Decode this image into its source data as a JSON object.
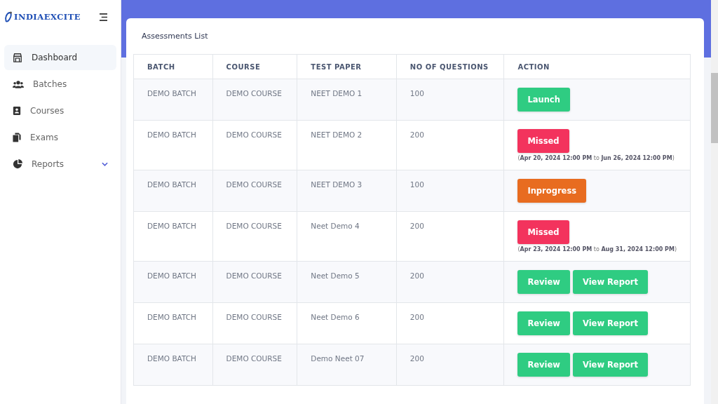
{
  "brand": {
    "name": "INDIAEXCITE"
  },
  "sidebar": {
    "items": [
      {
        "label": "Dashboard",
        "selected": true,
        "expandable": false
      },
      {
        "label": "Batches",
        "selected": false,
        "expandable": false
      },
      {
        "label": "Courses",
        "selected": false,
        "expandable": false
      },
      {
        "label": "Exams",
        "selected": false,
        "expandable": false
      },
      {
        "label": "Reports",
        "selected": false,
        "expandable": true
      }
    ]
  },
  "card": {
    "title": "Assessments List"
  },
  "table": {
    "columns": [
      "BATCH",
      "COURSE",
      "TEST PAPER",
      "NO OF QUESTIONS",
      "ACTION"
    ],
    "rows": [
      {
        "batch": "DEMO BATCH",
        "course": "DEMO COURSE",
        "paper": "NEET DEMO 1",
        "questions": "100",
        "actions": [
          {
            "kind": "launch",
            "label": "Launch"
          }
        ]
      },
      {
        "batch": "DEMO BATCH",
        "course": "DEMO COURSE",
        "paper": "NEET DEMO 2",
        "questions": "200",
        "actions": [
          {
            "kind": "missed",
            "label": "Missed"
          }
        ],
        "window": "(**Apr 20, 2024 12:00 PM** to **Jun 26, 2024 12:00 PM**)"
      },
      {
        "batch": "DEMO BATCH",
        "course": "DEMO COURSE",
        "paper": "NEET DEMO 3",
        "questions": "100",
        "actions": [
          {
            "kind": "inprogress",
            "label": "Inprogress"
          }
        ]
      },
      {
        "batch": "DEMO BATCH",
        "course": "DEMO COURSE",
        "paper": "Neet Demo 4",
        "questions": "200",
        "actions": [
          {
            "kind": "missed",
            "label": "Missed"
          }
        ],
        "window": "(**Apr 23, 2024 12:00 PM** to **Aug 31, 2024 12:00 PM**)"
      },
      {
        "batch": "DEMO BATCH",
        "course": "DEMO COURSE",
        "paper": "Neet Demo 5",
        "questions": "200",
        "actions": [
          {
            "kind": "review",
            "label": "Review"
          },
          {
            "kind": "report",
            "label": "View Report"
          }
        ]
      },
      {
        "batch": "DEMO BATCH",
        "course": "DEMO COURSE",
        "paper": "Neet Demo 6",
        "questions": "200",
        "actions": [
          {
            "kind": "review",
            "label": "Review"
          },
          {
            "kind": "report",
            "label": "View Report"
          }
        ]
      },
      {
        "batch": "DEMO BATCH",
        "course": "DEMO COURSE",
        "paper": "Demo Neet 07",
        "questions": "200",
        "actions": [
          {
            "kind": "review",
            "label": "Review"
          },
          {
            "kind": "report",
            "label": "View Report"
          }
        ]
      }
    ]
  }
}
